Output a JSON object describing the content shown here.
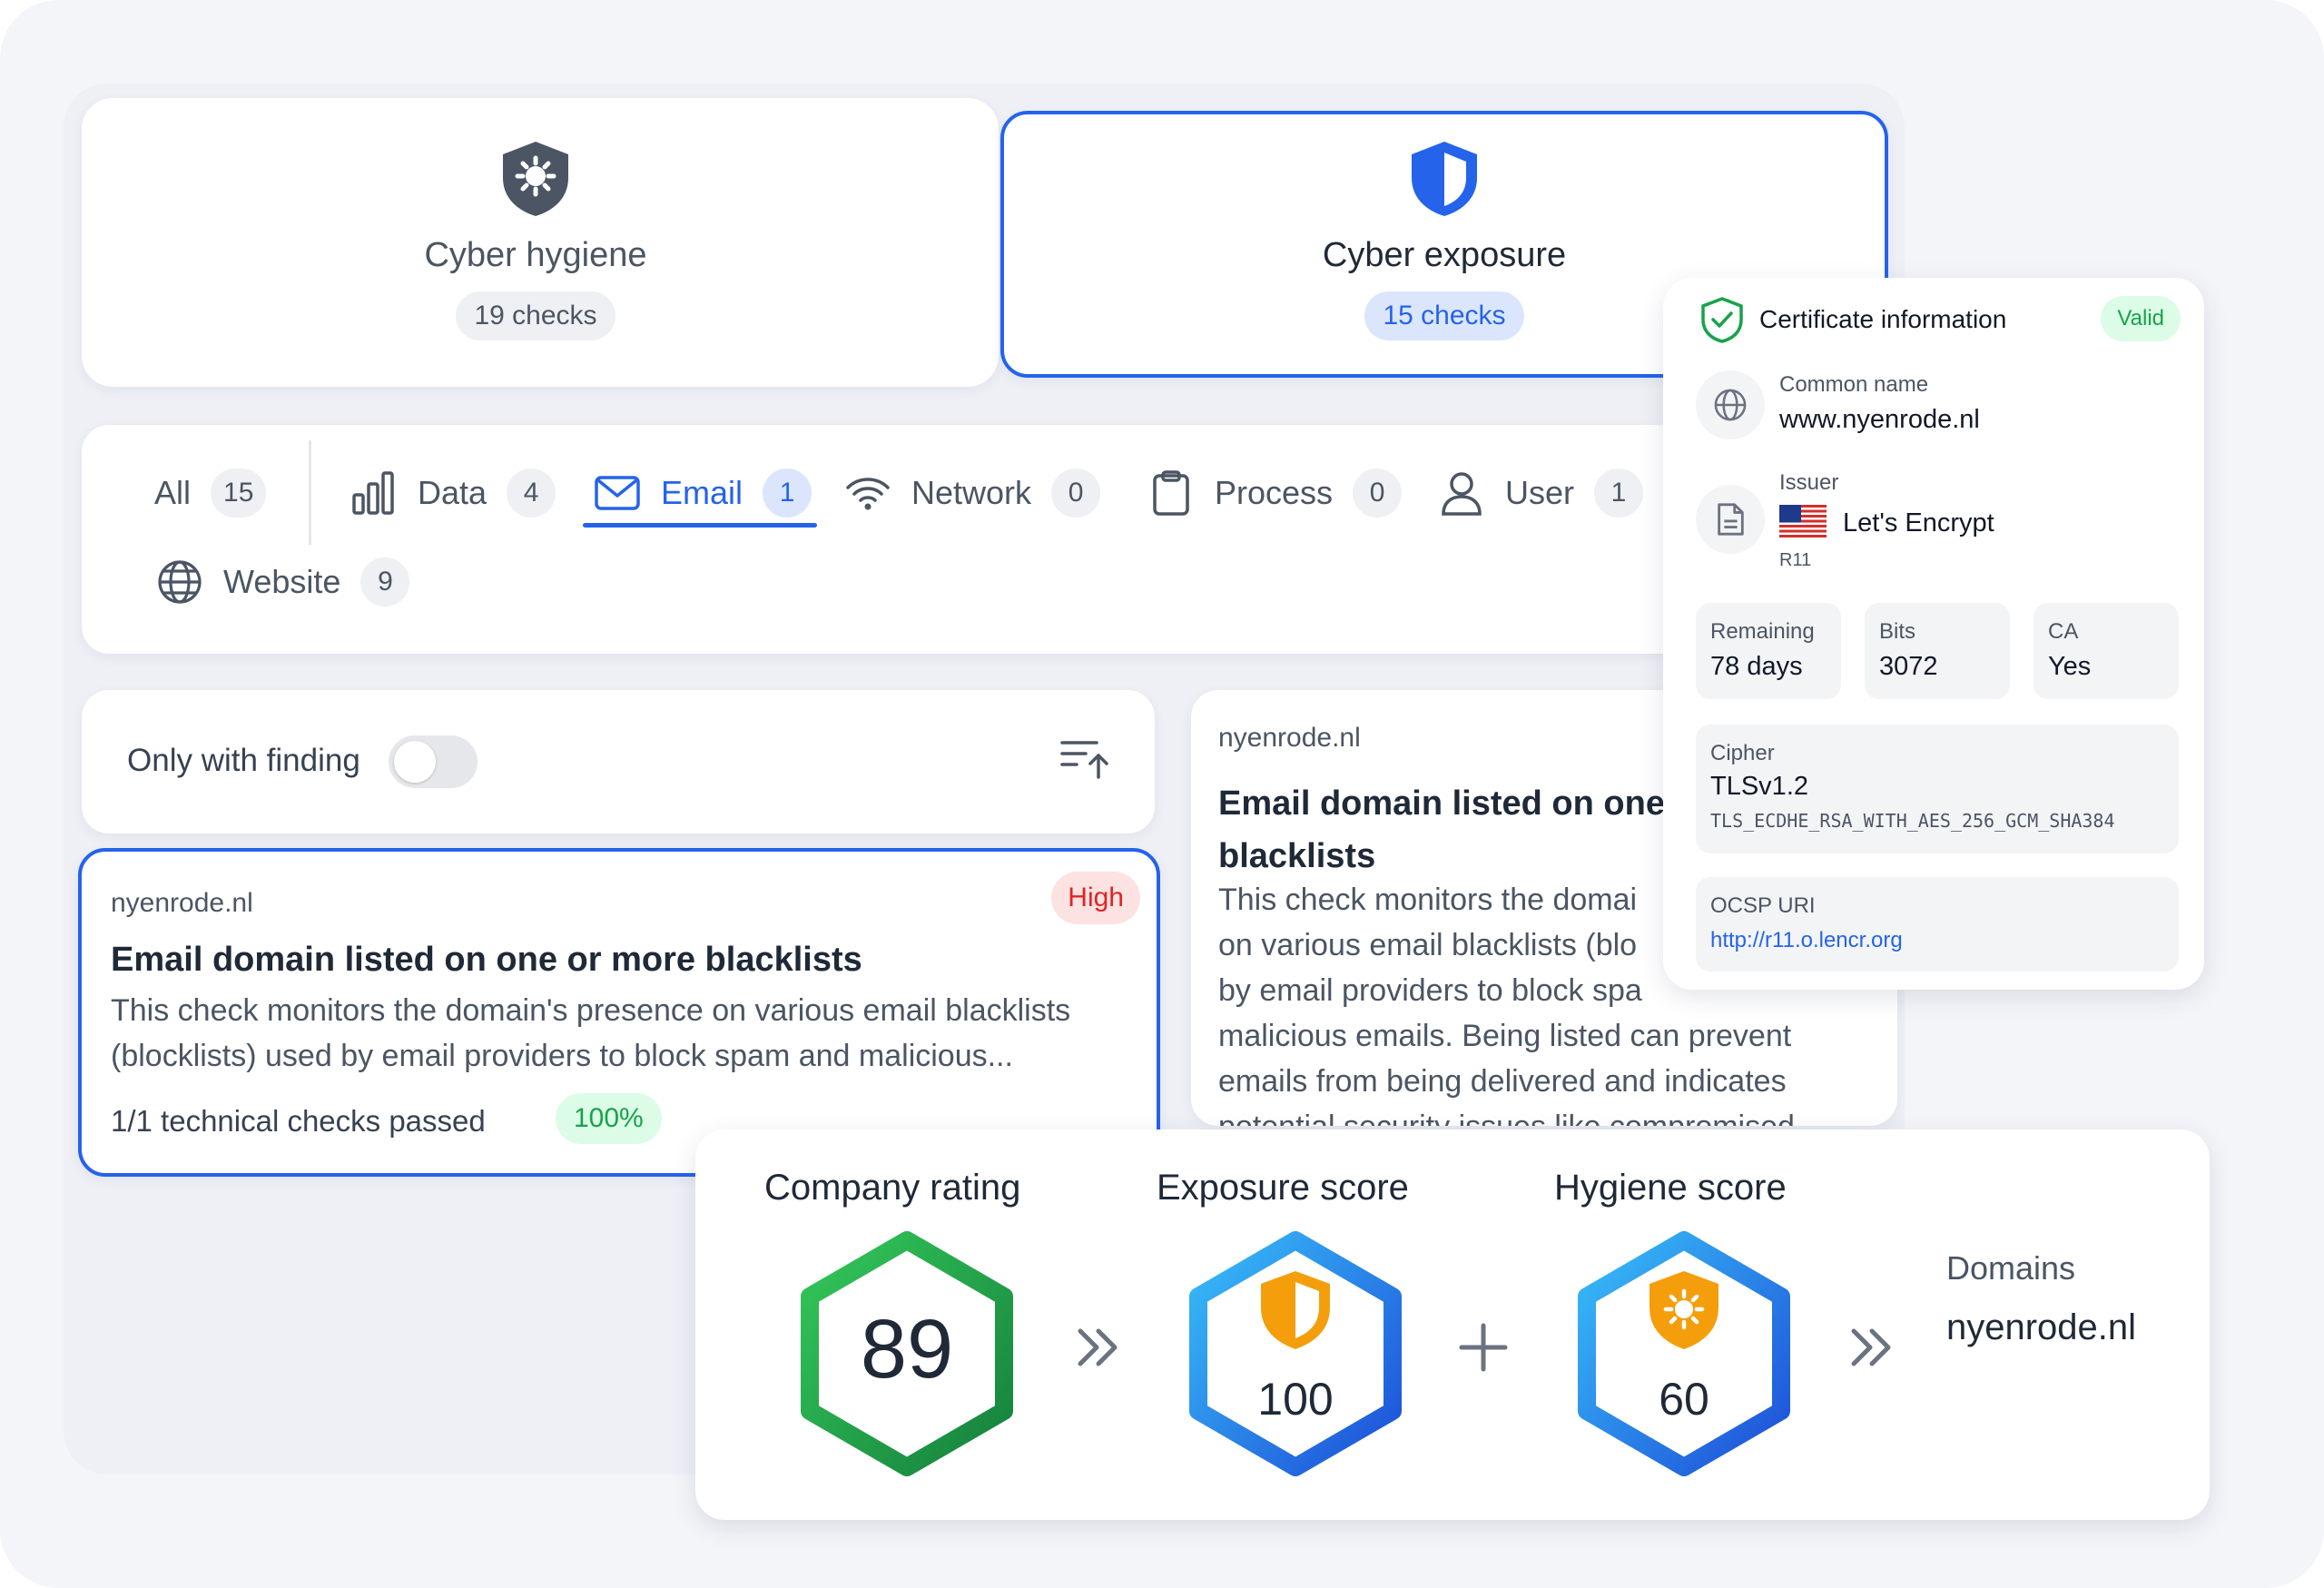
{
  "categories": [
    {
      "key": "hygiene",
      "label": "Cyber hygiene",
      "count": "19 checks",
      "icon": "virus-shield-icon",
      "selected": false
    },
    {
      "key": "exposure",
      "label": "Cyber exposure",
      "count": "15 checks",
      "icon": "shield-icon",
      "selected": true
    }
  ],
  "tabs": [
    {
      "label": "All",
      "count": "15",
      "icon": ""
    },
    {
      "label": "Data",
      "count": "4",
      "icon": "bar-chart-icon"
    },
    {
      "label": "Email",
      "count": "1",
      "icon": "envelope-icon",
      "active": true
    },
    {
      "label": "Network",
      "count": "0",
      "icon": "wifi-icon"
    },
    {
      "label": "Process",
      "count": "0",
      "icon": "clipboard-icon"
    },
    {
      "label": "User",
      "count": "1",
      "icon": "user-icon"
    },
    {
      "label": "Website",
      "count": "9",
      "icon": "globe-icon"
    }
  ],
  "filter": {
    "only_with_finding_label": "Only with finding",
    "only_with_finding": false
  },
  "check_item": {
    "domain": "nyenrode.nl",
    "severity": "High",
    "title": "Email domain listed on one or more blacklists",
    "description_line1": "This check monitors the domain's presence on various email blacklists",
    "description_line2": "(blocklists) used by email providers to block spam and malicious...",
    "checks_passed": "1/1 technical checks passed",
    "percent": "100%"
  },
  "detail": {
    "domain": "nyenrode.nl",
    "title_line1": "Email domain listed on one",
    "title_line2": "blacklists",
    "lines": [
      "This check monitors the domai",
      "on various email blacklists (blo",
      "by email providers to block spa",
      "malicious emails. Being listed can prevent",
      "emails from being delivered and indicates",
      "potential security issues like compromised"
    ]
  },
  "certificate": {
    "title": "Certificate information",
    "status": "Valid",
    "common_name_label": "Common name",
    "common_name": "www.nyenrode.nl",
    "issuer_label": "Issuer",
    "issuer": "Let's Encrypt",
    "issuer_sub": "R11",
    "remaining_label": "Remaining",
    "remaining": "78 days",
    "bits_label": "Bits",
    "bits": "3072",
    "ca_label": "CA",
    "ca": "Yes",
    "cipher_label": "Cipher",
    "cipher": "TLSv1.2",
    "cipher_suite": "TLS_ECDHE_RSA_WITH_AES_256_GCM_SHA384",
    "ocsp_label": "OCSP URI",
    "ocsp": "http://r11.o.lencr.org"
  },
  "scores": {
    "company_rating_label": "Company rating",
    "company_rating": "89",
    "exposure_label": "Exposure score",
    "exposure": "100",
    "hygiene_label": "Hygiene score",
    "hygiene": "60",
    "domains_label": "Domains",
    "domains": "nyenrode.nl"
  },
  "colors": {
    "accent": "#2563eb",
    "high": "#e02424",
    "success": "#16a34a",
    "orange": "#f59e0b"
  }
}
